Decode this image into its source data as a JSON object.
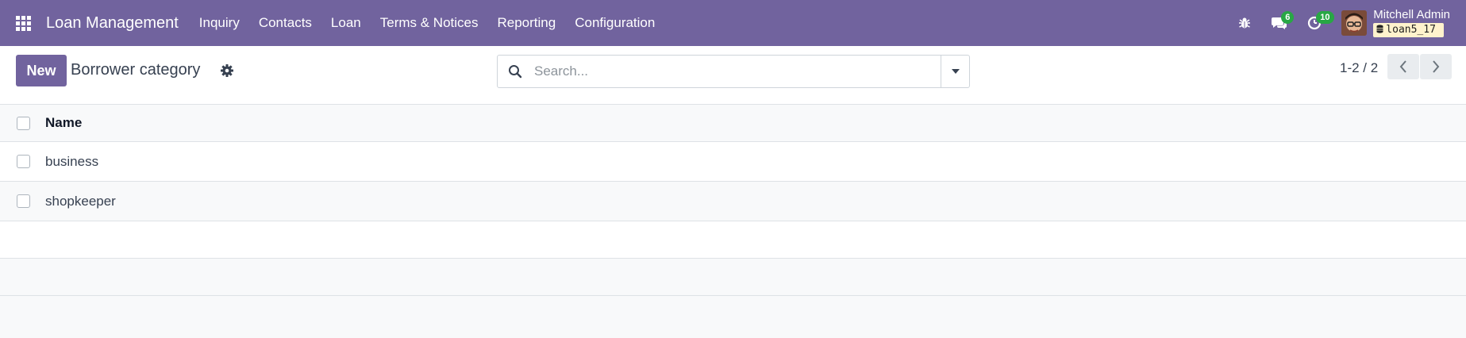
{
  "navbar": {
    "app_title": "Loan Management",
    "menu": [
      {
        "label": "Inquiry"
      },
      {
        "label": "Contacts"
      },
      {
        "label": "Loan"
      },
      {
        "label": "Terms & Notices"
      },
      {
        "label": "Reporting"
      },
      {
        "label": "Configuration"
      }
    ],
    "icons": {
      "apps": "grid-icon",
      "debug": "bug-icon",
      "messages": "chat-icon",
      "activities": "clock-icon"
    },
    "messages_count": "6",
    "activities_count": "10",
    "user_name": "Mitchell Admin",
    "database": "loan5_17"
  },
  "control_panel": {
    "new_label": "New",
    "title": "Borrower category",
    "search_placeholder": "Search...",
    "pager_value": "1-2 / 2"
  },
  "list": {
    "columns": [
      "Name"
    ],
    "rows": [
      {
        "name": "business"
      },
      {
        "name": "shopkeeper"
      }
    ]
  },
  "colors": {
    "brand": "#71639e",
    "badge": "#28a745",
    "db_badge": "#fff3cd"
  }
}
